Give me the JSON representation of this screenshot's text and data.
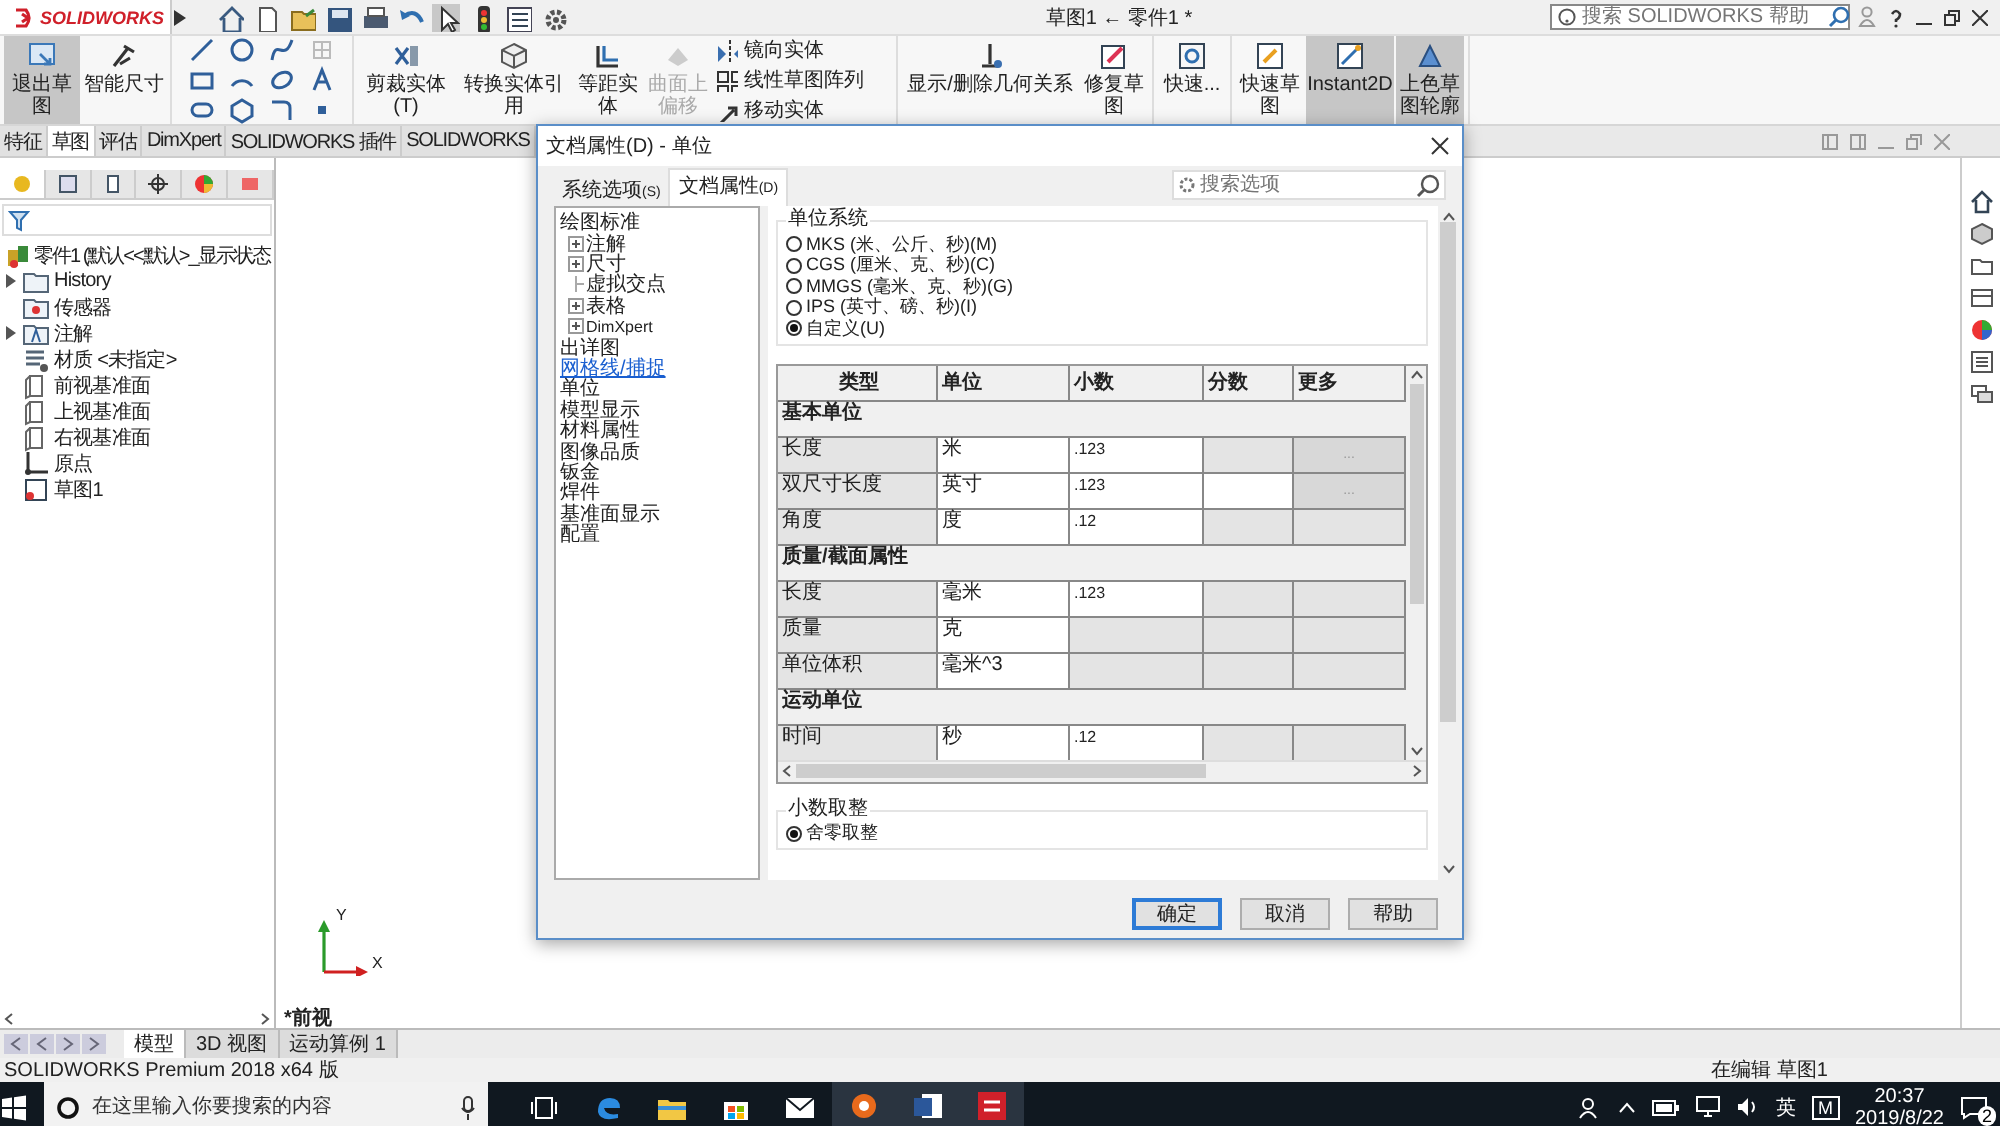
{
  "title_bar": {
    "logo": "SOLIDWORKS",
    "title": "草图1 ← 零件1 *",
    "search": {
      "placeholder": "搜索 SOLIDWORKS 帮助"
    }
  },
  "ribbon": {
    "groups": [
      {
        "buttons": [
          {
            "label": "退出草图",
            "selected": true,
            "disabled": false
          },
          {
            "label": "智能尺寸",
            "selected": false,
            "disabled": false
          }
        ]
      },
      {
        "kind": "tools"
      },
      {
        "buttons": [
          {
            "label": "剪裁实体(T)",
            "selected": false,
            "disabled": false
          },
          {
            "label": "转换实体引用",
            "selected": false,
            "disabled": false
          },
          {
            "label": "等距实体",
            "selected": false,
            "disabled": false
          },
          {
            "label": "曲面上偏移",
            "selected": false,
            "disabled": true
          }
        ],
        "small": [
          "镜向实体",
          "线性草图阵列",
          "移动实体"
        ]
      },
      {
        "buttons": [
          {
            "label": "显示/删除几何关系",
            "selected": false,
            "disabled": false
          },
          {
            "label": "修复草图",
            "selected": false,
            "disabled": false
          }
        ]
      },
      {
        "buttons": [
          {
            "label": "快速...",
            "selected": false,
            "disabled": false
          }
        ]
      },
      {
        "buttons": [
          {
            "label": "快速草图",
            "selected": false,
            "disabled": false
          },
          {
            "label": "Instant2D",
            "selected": true,
            "disabled": false
          },
          {
            "label": "上色草图轮廓",
            "selected": true,
            "disabled": false
          }
        ]
      }
    ]
  },
  "command_tabs": [
    {
      "label": "特征",
      "selected": false
    },
    {
      "label": "草图",
      "selected": true
    },
    {
      "label": "评估",
      "selected": false
    },
    {
      "label": "DimXpert",
      "selected": false
    },
    {
      "label": "SOLIDWORKS 插件",
      "selected": false
    },
    {
      "label": "SOLIDWORKS",
      "selected": false
    }
  ],
  "quick_access": [
    {
      "pressed": false
    },
    {
      "pressed": false
    },
    {
      "pressed": false
    },
    {
      "pressed": false
    },
    {
      "pressed": false
    },
    {
      "pressed": false
    },
    {
      "pressed": true
    },
    {
      "pressed": false
    },
    {
      "pressed": false
    },
    {
      "pressed": false
    }
  ],
  "panel_tabs": [
    {
      "selected": true
    },
    {
      "selected": false
    },
    {
      "selected": false
    },
    {
      "selected": false
    },
    {
      "selected": false
    },
    {
      "selected": false
    }
  ],
  "feature_tree": [
    {
      "label": "零件1  (默认<<默认>_显示状态",
      "kind": "part"
    },
    {
      "label": "History",
      "kind": "folder",
      "expanded": false
    },
    {
      "label": "传感器",
      "kind": "sensor"
    },
    {
      "label": "注解",
      "kind": "annotation",
      "expanded": false
    },
    {
      "label": "材质 <未指定>",
      "kind": "material"
    },
    {
      "label": "前视基准面",
      "kind": "plane"
    },
    {
      "label": "上视基准面",
      "kind": "plane"
    },
    {
      "label": "右视基准面",
      "kind": "plane"
    },
    {
      "label": "原点",
      "kind": "origin"
    },
    {
      "label": "草图1",
      "kind": "sketch"
    }
  ],
  "view_label": "*前视",
  "triad": {
    "y": "Y",
    "x": "X"
  },
  "dialog": {
    "title": "文档属性(D) - 单位",
    "tabs": [
      {
        "label": "系统选项",
        "key": "(S)",
        "selected": false
      },
      {
        "label": "文档属性",
        "key": "(D)",
        "selected": true
      }
    ],
    "search": {
      "placeholder": "搜索选项"
    },
    "tree": [
      {
        "label": "绘图标准",
        "kind": "item",
        "children": [
          {
            "label": "注解",
            "kind": "item",
            "expanded": false
          },
          {
            "label": "尺寸",
            "kind": "item",
            "expanded": false
          },
          {
            "label": "虚拟交点",
            "kind": "item"
          },
          {
            "label": "表格",
            "kind": "item",
            "expanded": false
          },
          {
            "label": "DimXpert",
            "kind": "small",
            "expanded": false
          }
        ]
      },
      {
        "label": "出详图",
        "kind": "item"
      },
      {
        "label": "网格线/捕捉",
        "kind": "link"
      },
      {
        "label": "单位",
        "kind": "item"
      },
      {
        "label": "模型显示",
        "kind": "item"
      },
      {
        "label": "材料属性",
        "kind": "item"
      },
      {
        "label": "图像品质",
        "kind": "item"
      },
      {
        "label": "钣金",
        "kind": "item"
      },
      {
        "label": "焊件",
        "kind": "item"
      },
      {
        "label": "基准面显示",
        "kind": "item"
      },
      {
        "label": "配置",
        "kind": "item"
      }
    ],
    "unit_system": {
      "title": "单位系统",
      "options": [
        {
          "label": "MKS (米、公斤、秒)(M)",
          "selected": false
        },
        {
          "label": "CGS (厘米、克、秒)(C)",
          "selected": false
        },
        {
          "label": "MMGS (毫米、克、秒)(G)",
          "selected": false
        },
        {
          "label": "IPS (英寸、磅、秒)(I)",
          "selected": false
        },
        {
          "label": "自定义(U)",
          "selected": true
        }
      ]
    },
    "table": {
      "columns": [
        "类型",
        "单位",
        "小数",
        "分数",
        "更多"
      ],
      "rows": [
        {
          "kind": "section",
          "label": "基本单位"
        },
        {
          "kind": "unit",
          "type": "长度",
          "unit": "米",
          "decimal": ".123",
          "fraction_enabled": false,
          "more": "..."
        },
        {
          "kind": "unit",
          "type": "双尺寸长度",
          "unit": "英寸",
          "decimal": ".123",
          "fraction_enabled": true,
          "more": "..."
        },
        {
          "kind": "unit",
          "type": "角度",
          "unit": "度",
          "decimal": ".12",
          "fraction_enabled": false
        },
        {
          "kind": "section",
          "label": "质量/截面属性"
        },
        {
          "kind": "unit",
          "type": "长度",
          "unit": "毫米",
          "decimal": ".123",
          "fraction_enabled": false
        },
        {
          "kind": "unit",
          "type": "质量",
          "unit": "克",
          "fraction_enabled": false
        },
        {
          "kind": "unit",
          "type": "单位体积",
          "unit": "毫米^3",
          "fraction_enabled": false
        },
        {
          "kind": "section",
          "label": "运动单位"
        },
        {
          "kind": "unit",
          "type": "时间",
          "unit": "秒",
          "decimal": ".12",
          "fraction_enabled": false
        }
      ]
    },
    "rounding": {
      "title": "小数取整",
      "options": [
        {
          "label": "舍零取整",
          "selected": true
        }
      ]
    },
    "buttons": [
      {
        "label": "确定",
        "default": true
      },
      {
        "label": "取消",
        "default": false
      },
      {
        "label": "帮助",
        "default": false
      }
    ]
  },
  "bottom_tabs": [
    {
      "label": "模型",
      "selected": true
    },
    {
      "label": "3D 视图",
      "selected": false
    },
    {
      "label": "运动算例 1",
      "selected": false
    }
  ],
  "status_bar": {
    "product": "SOLIDWORKS Premium 2018 x64 版",
    "state": "在编辑 草图1"
  },
  "taskbar": {
    "search": {
      "placeholder": "在这里输入你要搜索的内容"
    },
    "ime": "英",
    "ime_mode": "M",
    "time": "20:37",
    "date": "2019/8/22",
    "notifications": "2"
  }
}
